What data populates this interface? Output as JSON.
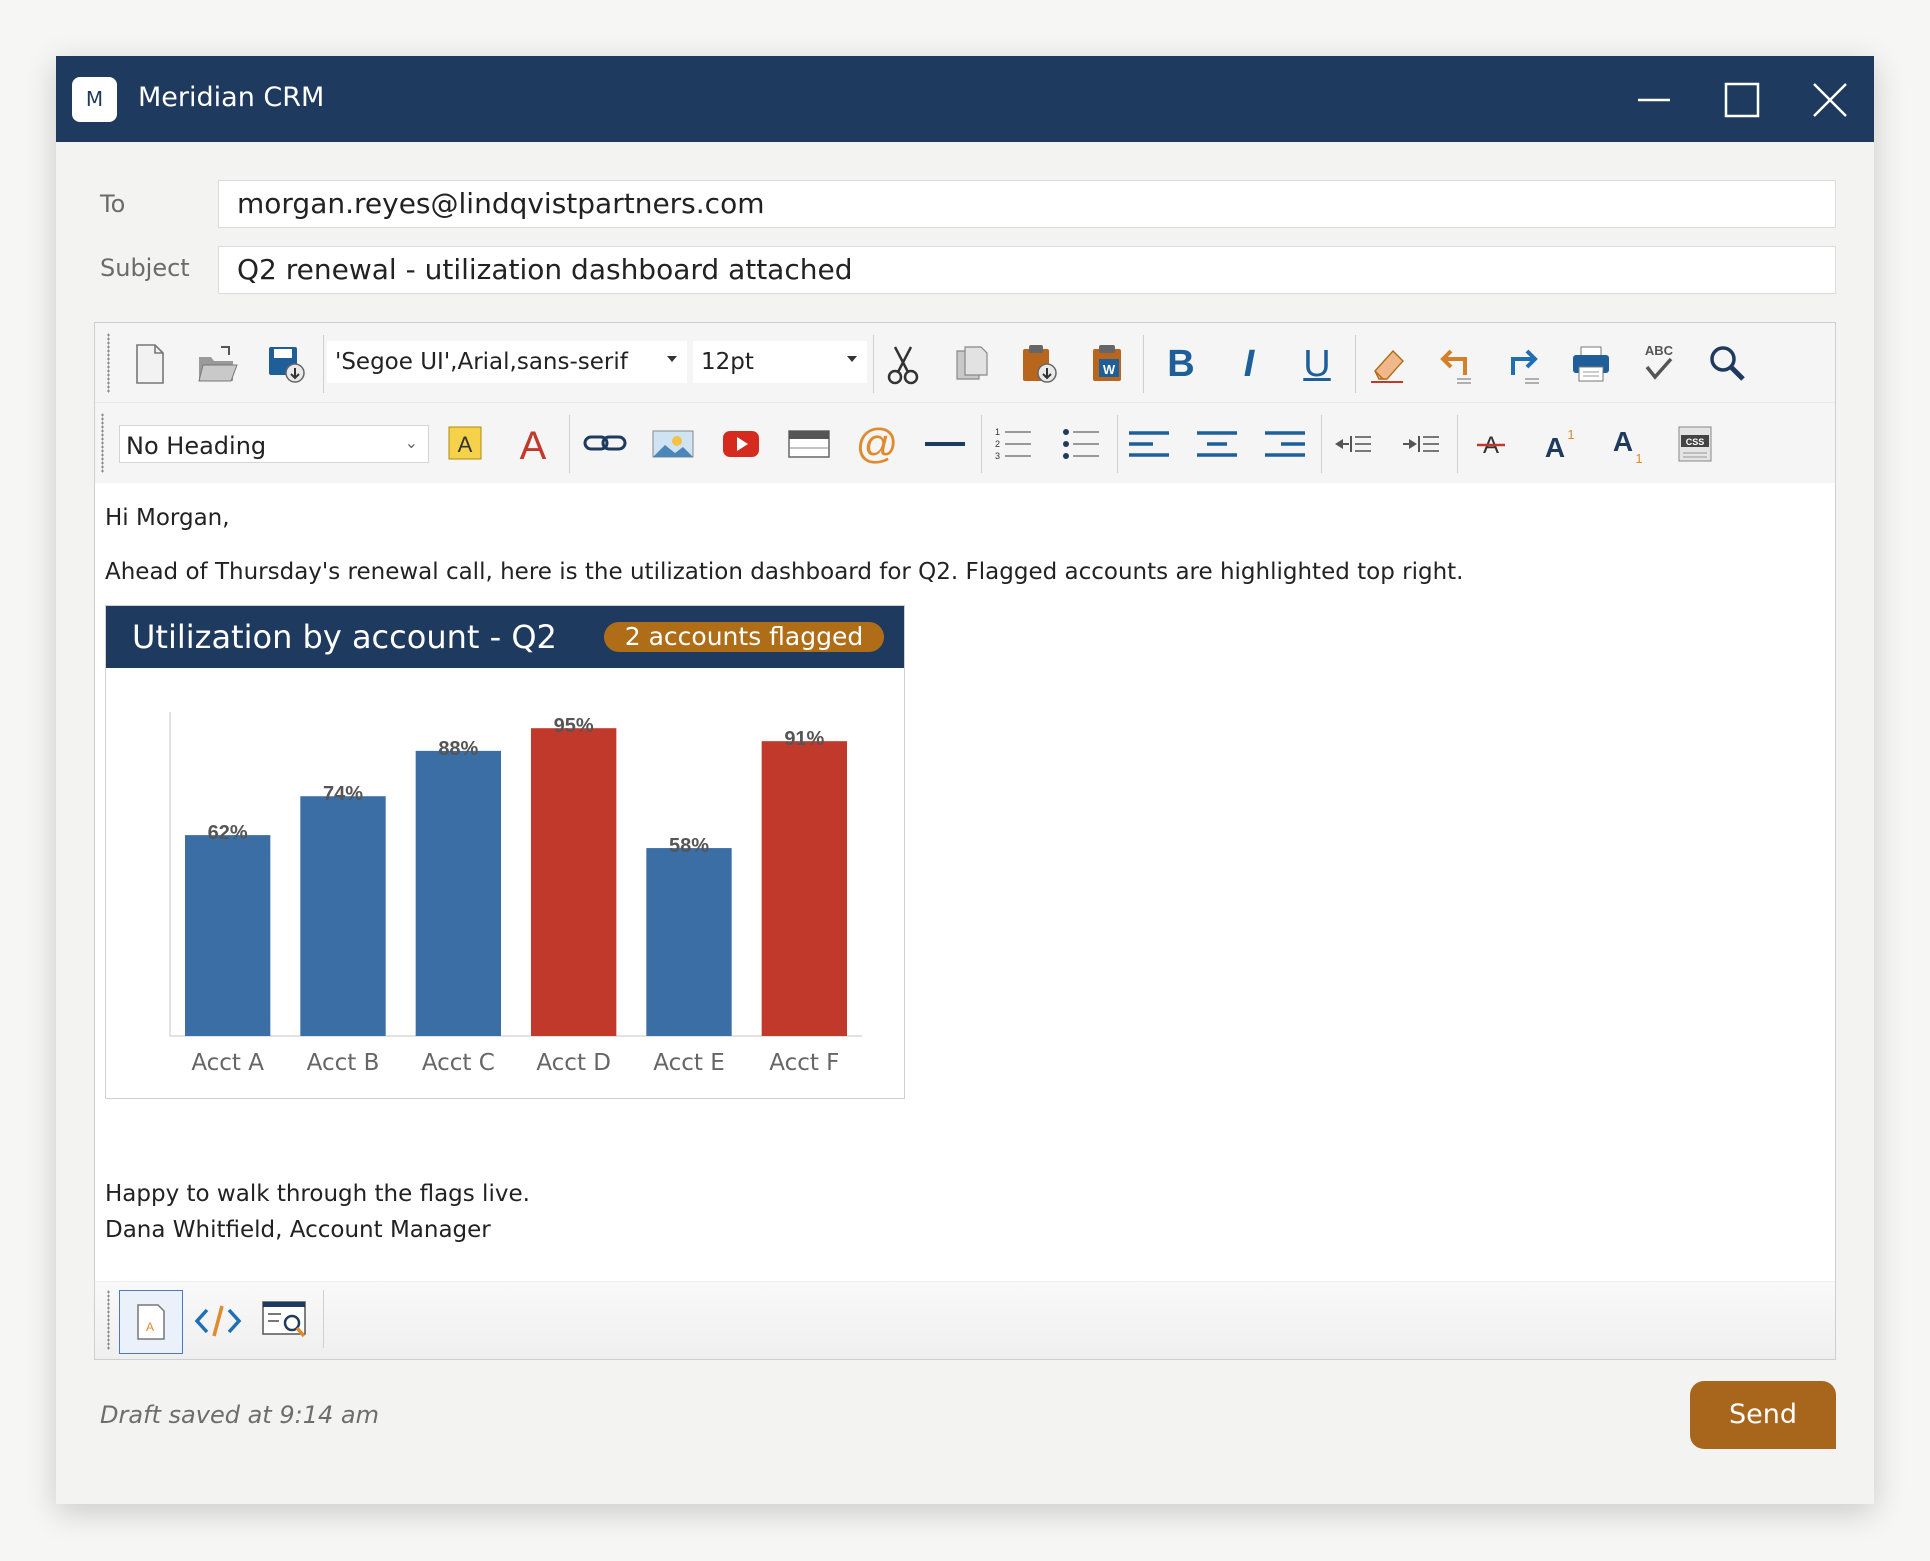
{
  "window": {
    "title": "Meridian CRM",
    "logo_letter": "M"
  },
  "compose": {
    "to_label": "To",
    "to_value": "morgan.reyes@lindqvistpartners.com",
    "subject_label": "Subject",
    "subject_value": "Q2 renewal - utilization dashboard attached"
  },
  "toolbar": {
    "font_family": "'Segoe UI',Arial,sans-serif",
    "font_size": "12pt",
    "heading": "No Heading",
    "bold": "B",
    "italic": "I",
    "underline": "U",
    "spellcheck_text": "ABC",
    "highlight_letter": "A",
    "font_color_letter": "A",
    "mention_symbol": "@",
    "superscript_letter": "A",
    "superscript_mark": "1",
    "subscript_letter": "A",
    "subscript_mark": "1",
    "css_text": "CSS"
  },
  "body": {
    "greeting": "Hi Morgan,",
    "intro": "Ahead of Thursday's renewal call, here is the utilization dashboard for Q2. Flagged accounts are highlighted top right.",
    "closing": "Happy to walk through the flags live.",
    "signature": "Dana Whitfield, Account Manager"
  },
  "dashboard": {
    "title": "Utilization by account - Q2",
    "badge": "2 accounts flagged"
  },
  "chart_data": {
    "type": "bar",
    "categories": [
      "Acct A",
      "Acct B",
      "Acct C",
      "Acct D",
      "Acct E",
      "Acct F"
    ],
    "values": [
      62,
      74,
      88,
      95,
      58,
      91
    ],
    "data_labels": [
      "62%",
      "74%",
      "88%",
      "95%",
      "58%",
      "91%"
    ],
    "flagged": [
      false,
      false,
      false,
      true,
      false,
      true
    ],
    "colors": {
      "normal": "#3a6ea5",
      "flagged": "#c0392b"
    },
    "title": "",
    "xlabel": "",
    "ylabel": "",
    "ylim": [
      0,
      100
    ],
    "grid": false
  },
  "footer": {
    "status": "Draft saved at 9:14 am",
    "send_label": "Send"
  }
}
